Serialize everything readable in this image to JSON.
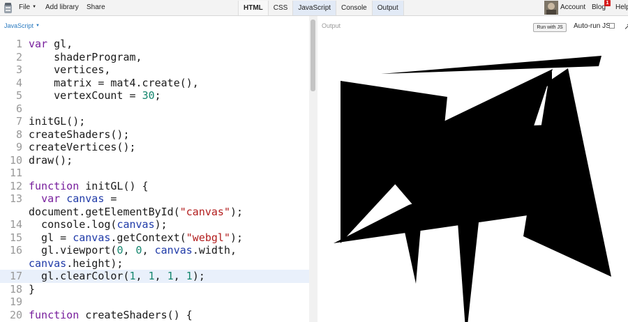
{
  "menubar": {
    "file": "File",
    "add_library": "Add library",
    "share": "Share",
    "account": "Account",
    "blog": "Blog",
    "blog_badge": "1",
    "help": "Help"
  },
  "tabs": [
    {
      "label": "HTML"
    },
    {
      "label": "CSS"
    },
    {
      "label": "JavaScript"
    },
    {
      "label": "Console"
    },
    {
      "label": "Output"
    }
  ],
  "editor": {
    "language": "JavaScript",
    "lines": [
      {
        "num": "1",
        "tokens": [
          [
            "kw",
            "var"
          ],
          [
            "",
            "gl,"
          ]
        ]
      },
      {
        "num": "2",
        "tokens": [
          [
            "",
            "    shaderProgram,"
          ]
        ]
      },
      {
        "num": "3",
        "tokens": [
          [
            "",
            "    vertices,"
          ]
        ]
      },
      {
        "num": "4",
        "tokens": [
          [
            "",
            "    matrix = mat4.create(),"
          ]
        ]
      },
      {
        "num": "5",
        "tokens": [
          [
            "",
            "    vertexCount = "
          ],
          [
            "num",
            "30"
          ],
          [
            "",
            ";"
          ]
        ]
      },
      {
        "num": "6",
        "tokens": []
      },
      {
        "num": "7",
        "tokens": [
          [
            "",
            "initGL();"
          ]
        ]
      },
      {
        "num": "8",
        "tokens": [
          [
            "",
            "createShaders();"
          ]
        ]
      },
      {
        "num": "9",
        "tokens": [
          [
            "",
            "createVertices();"
          ]
        ]
      },
      {
        "num": "10",
        "tokens": [
          [
            "",
            "draw();"
          ]
        ]
      },
      {
        "num": "11",
        "tokens": []
      },
      {
        "num": "12",
        "tokens": [
          [
            "kw",
            "function"
          ],
          [
            "",
            ""
          ],
          [
            "",
            "initGL() {"
          ]
        ]
      },
      {
        "num": "13",
        "tokens": [
          [
            "",
            "  "
          ],
          [
            "kw",
            "var"
          ],
          [
            "",
            ""
          ],
          [
            "var",
            "canvas"
          ],
          [
            "",
            " ="
          ]
        ]
      },
      {
        "num": "",
        "tokens": [
          [
            "",
            "document.getElementById("
          ],
          [
            "str",
            "\"canvas\""
          ],
          [
            "",
            ");"
          ]
        ]
      },
      {
        "num": "14",
        "tokens": [
          [
            "",
            "  console.log("
          ],
          [
            "var",
            "canvas"
          ],
          [
            "",
            ");"
          ]
        ]
      },
      {
        "num": "15",
        "tokens": [
          [
            "",
            "  gl = "
          ],
          [
            "var",
            "canvas"
          ],
          [
            "",
            ".getContext("
          ],
          [
            "str",
            "\"webgl\""
          ],
          [
            "",
            ");"
          ]
        ]
      },
      {
        "num": "16",
        "tokens": [
          [
            "",
            "  gl.viewport("
          ],
          [
            "num",
            "0"
          ],
          [
            "",
            ", "
          ],
          [
            "num",
            "0"
          ],
          [
            "",
            ", "
          ],
          [
            "var",
            "canvas"
          ],
          [
            "",
            ".width,"
          ]
        ]
      },
      {
        "num": "",
        "tokens": [
          [
            "var",
            "canvas"
          ],
          [
            "",
            ".height);"
          ]
        ]
      },
      {
        "num": "17",
        "tokens": [
          [
            "",
            "  gl.clearColor("
          ],
          [
            "num",
            "1"
          ],
          [
            "",
            ", "
          ],
          [
            "num",
            "1"
          ],
          [
            "",
            ", "
          ],
          [
            "num",
            "1"
          ],
          [
            "",
            ", "
          ],
          [
            "num",
            "1"
          ],
          [
            "",
            ");"
          ]
        ],
        "highlight": true
      },
      {
        "num": "18",
        "tokens": [
          [
            "",
            "}"
          ]
        ]
      },
      {
        "num": "19",
        "tokens": []
      },
      {
        "num": "20",
        "tokens": [
          [
            "kw",
            "function"
          ],
          [
            "",
            ""
          ],
          [
            "",
            "createShaders() {"
          ]
        ]
      }
    ]
  },
  "output": {
    "label": "Output",
    "run_button": "Run with JS",
    "autorun_label": "Auto-run JS",
    "autorun_checked": false,
    "fill_color": "#000000"
  }
}
